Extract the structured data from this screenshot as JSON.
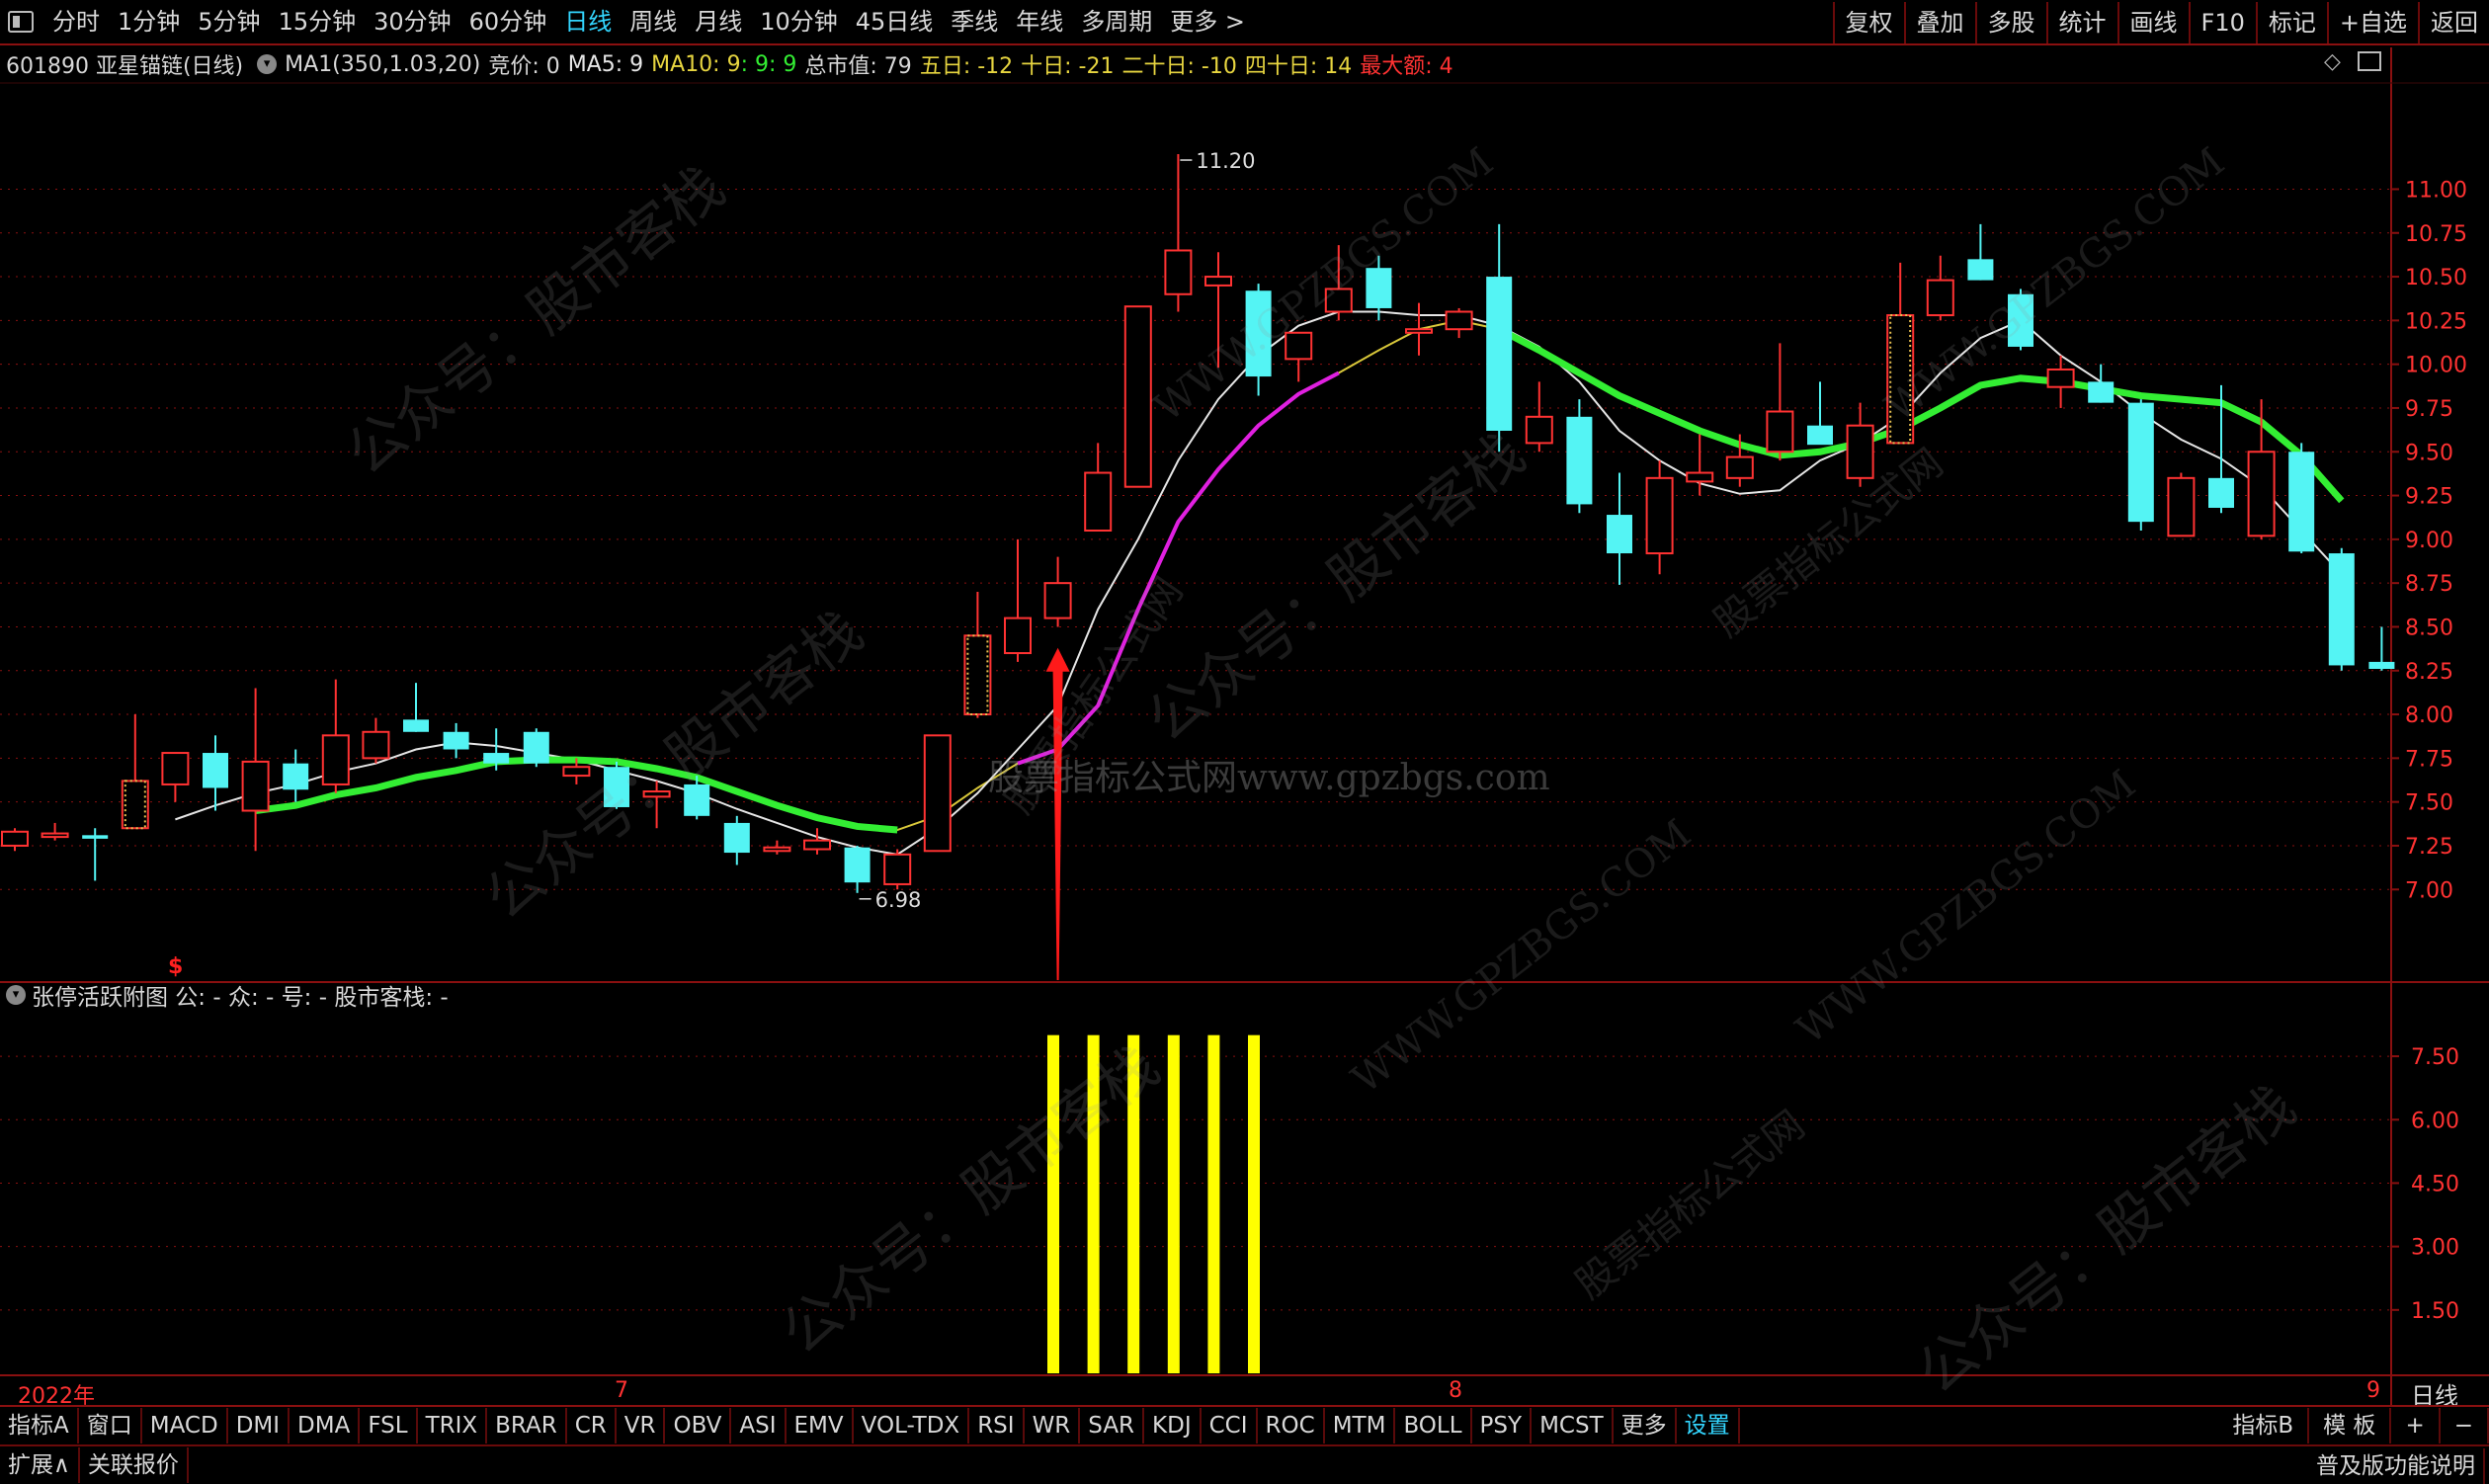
{
  "period_tabs": [
    "分时",
    "1分钟",
    "5分钟",
    "15分钟",
    "30分钟",
    "60分钟",
    "日线",
    "周线",
    "月线",
    "10分钟",
    "45日线",
    "季线",
    "年线",
    "多周期",
    "更多 >"
  ],
  "active_period": "日线",
  "right_tools": [
    "复权",
    "叠加",
    "多股",
    "统计",
    "画线",
    "F10",
    "标记",
    "+自选",
    "返回"
  ],
  "info": {
    "stock": "601890 亚星锚链(日线)",
    "ma1": "MA1(350,1.03,20)",
    "jingjia": "竞价: 0",
    "ma5": "MA5: 9",
    "ma10_label": "MA10: 9",
    "ma10_a": ": 9",
    "ma10_b": ": 9",
    "total_mv": "总市值: 79",
    "d5": "五日: -12",
    "d10": "十日: -21",
    "d20": "二十日: -10",
    "d40": "四十日: 14",
    "maxe": "最大额: 4"
  },
  "sub_info": "张停活跃附图 公: - 众: - 号: - 股市客栈: -",
  "date_labels": {
    "year": "2022年",
    "m7": "7",
    "m8": "8",
    "m9": "9",
    "right": "日线"
  },
  "bottom_tabs": [
    "指标A",
    "窗口",
    "MACD",
    "DMI",
    "DMA",
    "FSL",
    "TRIX",
    "BRAR",
    "CR",
    "VR",
    "OBV",
    "ASI",
    "EMV",
    "VOL-TDX",
    "RSI",
    "WR",
    "SAR",
    "KDJ",
    "CCI",
    "ROC",
    "MTM",
    "BOLL",
    "PSY",
    "MCST",
    "更多",
    "设置"
  ],
  "bottom_right_tabs": [
    "指标B",
    "模 板",
    "+",
    "−"
  ],
  "footer_left": [
    "扩展∧",
    "关联报价"
  ],
  "footer_right": "普及版功能说明",
  "watermarks": [
    "公众号：股市客栈",
    "股票指标公式网",
    "WWW.GPZBGS.COM",
    "股票指标公式网www.gpzbgs.com"
  ],
  "colors": {
    "up": "#ff3232",
    "down": "#54f4f4",
    "ma_white": "#e6e6e6",
    "ma_yellow": "#d9c83a",
    "ma_green": "#33ee33",
    "ma_magenta": "#e020e0",
    "signal": "#ffff00",
    "arrow": "#ff1a1a",
    "grid": "#8a1010"
  },
  "chart_data": [
    {
      "type": "candlestick",
      "title": "601890 亚星锚链(日线)",
      "yticks": [
        7.0,
        7.25,
        7.5,
        7.75,
        8.0,
        8.25,
        8.5,
        8.75,
        9.0,
        9.25,
        9.5,
        9.75,
        10.0,
        10.25,
        10.5,
        10.75,
        11.0
      ],
      "ylim": [
        6.55,
        11.55
      ],
      "annotations": [
        {
          "text": "11.20",
          "index": 29
        },
        {
          "text": "6.98",
          "index": 21
        }
      ],
      "candles": [
        {
          "o": 7.25,
          "h": 7.35,
          "l": 7.22,
          "c": 7.33
        },
        {
          "o": 7.3,
          "h": 7.38,
          "l": 7.28,
          "c": 7.32
        },
        {
          "o": 7.31,
          "h": 7.35,
          "l": 7.05,
          "c": 7.29
        },
        {
          "o": 7.35,
          "h": 8.0,
          "l": 7.35,
          "c": 7.62
        },
        {
          "o": 7.6,
          "h": 7.78,
          "l": 7.5,
          "c": 7.78
        },
        {
          "o": 7.78,
          "h": 7.88,
          "l": 7.45,
          "c": 7.58
        },
        {
          "o": 7.45,
          "h": 8.15,
          "l": 7.22,
          "c": 7.73
        },
        {
          "o": 7.72,
          "h": 7.8,
          "l": 7.5,
          "c": 7.57
        },
        {
          "o": 7.6,
          "h": 8.2,
          "l": 7.55,
          "c": 7.88
        },
        {
          "o": 7.75,
          "h": 7.98,
          "l": 7.72,
          "c": 7.9
        },
        {
          "o": 7.97,
          "h": 8.18,
          "l": 7.9,
          "c": 7.9
        },
        {
          "o": 7.9,
          "h": 7.95,
          "l": 7.75,
          "c": 7.8
        },
        {
          "o": 7.78,
          "h": 7.92,
          "l": 7.68,
          "c": 7.72
        },
        {
          "o": 7.9,
          "h": 7.92,
          "l": 7.7,
          "c": 7.72
        },
        {
          "o": 7.65,
          "h": 7.75,
          "l": 7.6,
          "c": 7.7
        },
        {
          "o": 7.7,
          "h": 7.73,
          "l": 7.46,
          "c": 7.47
        },
        {
          "o": 7.53,
          "h": 7.62,
          "l": 7.35,
          "c": 7.56
        },
        {
          "o": 7.6,
          "h": 7.65,
          "l": 7.4,
          "c": 7.42
        },
        {
          "o": 7.38,
          "h": 7.42,
          "l": 7.14,
          "c": 7.21
        },
        {
          "o": 7.22,
          "h": 7.28,
          "l": 7.2,
          "c": 7.24
        },
        {
          "o": 7.23,
          "h": 7.35,
          "l": 7.2,
          "c": 7.28
        },
        {
          "o": 7.24,
          "h": 7.25,
          "l": 6.98,
          "c": 7.04
        },
        {
          "o": 7.03,
          "h": 7.23,
          "l": 7.0,
          "c": 7.2
        },
        {
          "o": 7.22,
          "h": 7.88,
          "l": 7.22,
          "c": 7.88
        },
        {
          "o": 8.0,
          "h": 8.7,
          "l": 7.98,
          "c": 8.45
        },
        {
          "o": 8.35,
          "h": 9.0,
          "l": 8.3,
          "c": 8.55
        },
        {
          "o": 8.55,
          "h": 8.9,
          "l": 8.5,
          "c": 8.75
        },
        {
          "o": 9.05,
          "h": 9.55,
          "l": 9.05,
          "c": 9.38
        },
        {
          "o": 9.3,
          "h": 10.33,
          "l": 9.3,
          "c": 10.33
        },
        {
          "o": 10.4,
          "h": 11.2,
          "l": 10.3,
          "c": 10.65
        },
        {
          "o": 10.45,
          "h": 10.64,
          "l": 9.98,
          "c": 10.5
        },
        {
          "o": 10.42,
          "h": 10.46,
          "l": 9.82,
          "c": 9.93
        },
        {
          "o": 10.03,
          "h": 10.15,
          "l": 9.9,
          "c": 10.18
        },
        {
          "o": 10.3,
          "h": 10.68,
          "l": 10.25,
          "c": 10.43
        },
        {
          "o": 10.55,
          "h": 10.62,
          "l": 10.25,
          "c": 10.32
        },
        {
          "o": 10.18,
          "h": 10.35,
          "l": 10.05,
          "c": 10.2
        },
        {
          "o": 10.2,
          "h": 10.32,
          "l": 10.15,
          "c": 10.3
        },
        {
          "o": 10.5,
          "h": 10.8,
          "l": 9.5,
          "c": 9.62
        },
        {
          "o": 9.55,
          "h": 9.9,
          "l": 9.5,
          "c": 9.7
        },
        {
          "o": 9.7,
          "h": 9.8,
          "l": 9.15,
          "c": 9.2
        },
        {
          "o": 9.14,
          "h": 9.38,
          "l": 8.74,
          "c": 8.92
        },
        {
          "o": 8.92,
          "h": 9.45,
          "l": 8.8,
          "c": 9.35
        },
        {
          "o": 9.33,
          "h": 9.6,
          "l": 9.25,
          "c": 9.38
        },
        {
          "o": 9.35,
          "h": 9.6,
          "l": 9.3,
          "c": 9.47
        },
        {
          "o": 9.5,
          "h": 10.12,
          "l": 9.45,
          "c": 9.73
        },
        {
          "o": 9.65,
          "h": 9.9,
          "l": 9.6,
          "c": 9.54
        },
        {
          "o": 9.35,
          "h": 9.78,
          "l": 9.3,
          "c": 9.65
        },
        {
          "o": 9.55,
          "h": 10.58,
          "l": 9.55,
          "c": 10.28
        },
        {
          "o": 10.28,
          "h": 10.62,
          "l": 10.25,
          "c": 10.48
        },
        {
          "o": 10.6,
          "h": 10.8,
          "l": 10.48,
          "c": 10.48
        },
        {
          "o": 10.4,
          "h": 10.43,
          "l": 10.08,
          "c": 10.1
        },
        {
          "o": 9.87,
          "h": 10.05,
          "l": 9.75,
          "c": 9.97
        },
        {
          "o": 9.9,
          "h": 10.0,
          "l": 9.78,
          "c": 9.78
        },
        {
          "o": 9.78,
          "h": 9.8,
          "l": 9.05,
          "c": 9.1
        },
        {
          "o": 9.02,
          "h": 9.38,
          "l": 9.02,
          "c": 9.35
        },
        {
          "o": 9.35,
          "h": 9.88,
          "l": 9.15,
          "c": 9.18
        },
        {
          "o": 9.02,
          "h": 9.8,
          "l": 9.0,
          "c": 9.5
        },
        {
          "o": 9.5,
          "h": 9.55,
          "l": 8.92,
          "c": 8.93
        },
        {
          "o": 8.92,
          "h": 8.95,
          "l": 8.25,
          "c": 8.28
        },
        {
          "o": 8.3,
          "h": 8.5,
          "l": 8.25,
          "c": 8.26
        }
      ],
      "yellow_boxes": [
        {
          "index": 23,
          "low": 7.25,
          "high": 7.88
        },
        {
          "index": 28,
          "low": 9.3,
          "high": 10.33
        }
      ],
      "hollow_rects": [
        {
          "index": 3
        },
        {
          "index": 24
        },
        {
          "index": 47
        }
      ],
      "signal_arrow": {
        "index": 26,
        "top_value": 8.38
      },
      "ma_white": [
        null,
        null,
        null,
        null,
        7.4,
        7.48,
        7.55,
        7.6,
        7.67,
        7.72,
        7.8,
        7.84,
        7.82,
        7.78,
        7.74,
        7.68,
        7.62,
        7.55,
        7.46,
        7.38,
        7.3,
        7.24,
        7.2,
        7.35,
        7.55,
        7.8,
        8.05,
        8.6,
        9.0,
        9.45,
        9.8,
        10.05,
        10.22,
        10.3,
        10.3,
        10.28,
        10.28,
        10.22,
        10.1,
        9.9,
        9.62,
        9.45,
        9.32,
        9.26,
        9.28,
        9.45,
        9.55,
        9.7,
        9.95,
        10.15,
        10.25,
        10.05,
        9.9,
        9.72,
        9.57,
        9.46,
        9.3,
        9.05,
        8.8
      ],
      "ma_yellow": [
        null,
        null,
        null,
        null,
        null,
        null,
        7.45,
        7.48,
        7.54,
        7.58,
        7.64,
        7.68,
        7.73,
        7.74,
        7.74,
        7.73,
        7.69,
        7.64,
        7.56,
        7.48,
        7.41,
        7.36,
        7.34,
        7.42,
        7.58,
        7.72,
        7.8,
        8.05,
        8.6,
        9.1,
        9.4,
        9.65,
        9.83,
        9.95,
        10.08,
        10.2,
        10.25,
        10.2,
        10.08,
        9.95,
        9.82,
        9.72,
        9.62,
        9.54,
        9.48,
        9.5,
        9.55,
        9.63,
        9.75,
        9.88,
        9.92,
        9.9,
        9.86,
        9.82,
        9.8,
        9.78,
        9.67,
        9.48,
        9.22
      ],
      "ma_green_range": [
        0,
        22
      ],
      "ma_green2_range": [
        37,
        58
      ],
      "ma_magenta_range": [
        25,
        33
      ],
      "sub_chart": {
        "name": "张停活跃附图",
        "yticks": [
          1.5,
          3.0,
          4.5,
          6.0,
          7.5
        ],
        "ylim": [
          0,
          8.6
        ],
        "bars": [
          {
            "index": 26,
            "value": 8.0
          },
          {
            "index": 27,
            "value": 8.0
          },
          {
            "index": 28,
            "value": 8.0
          },
          {
            "index": 29,
            "value": 8.0
          },
          {
            "index": 30,
            "value": 8.0
          },
          {
            "index": 31,
            "value": 8.0
          }
        ]
      }
    }
  ]
}
